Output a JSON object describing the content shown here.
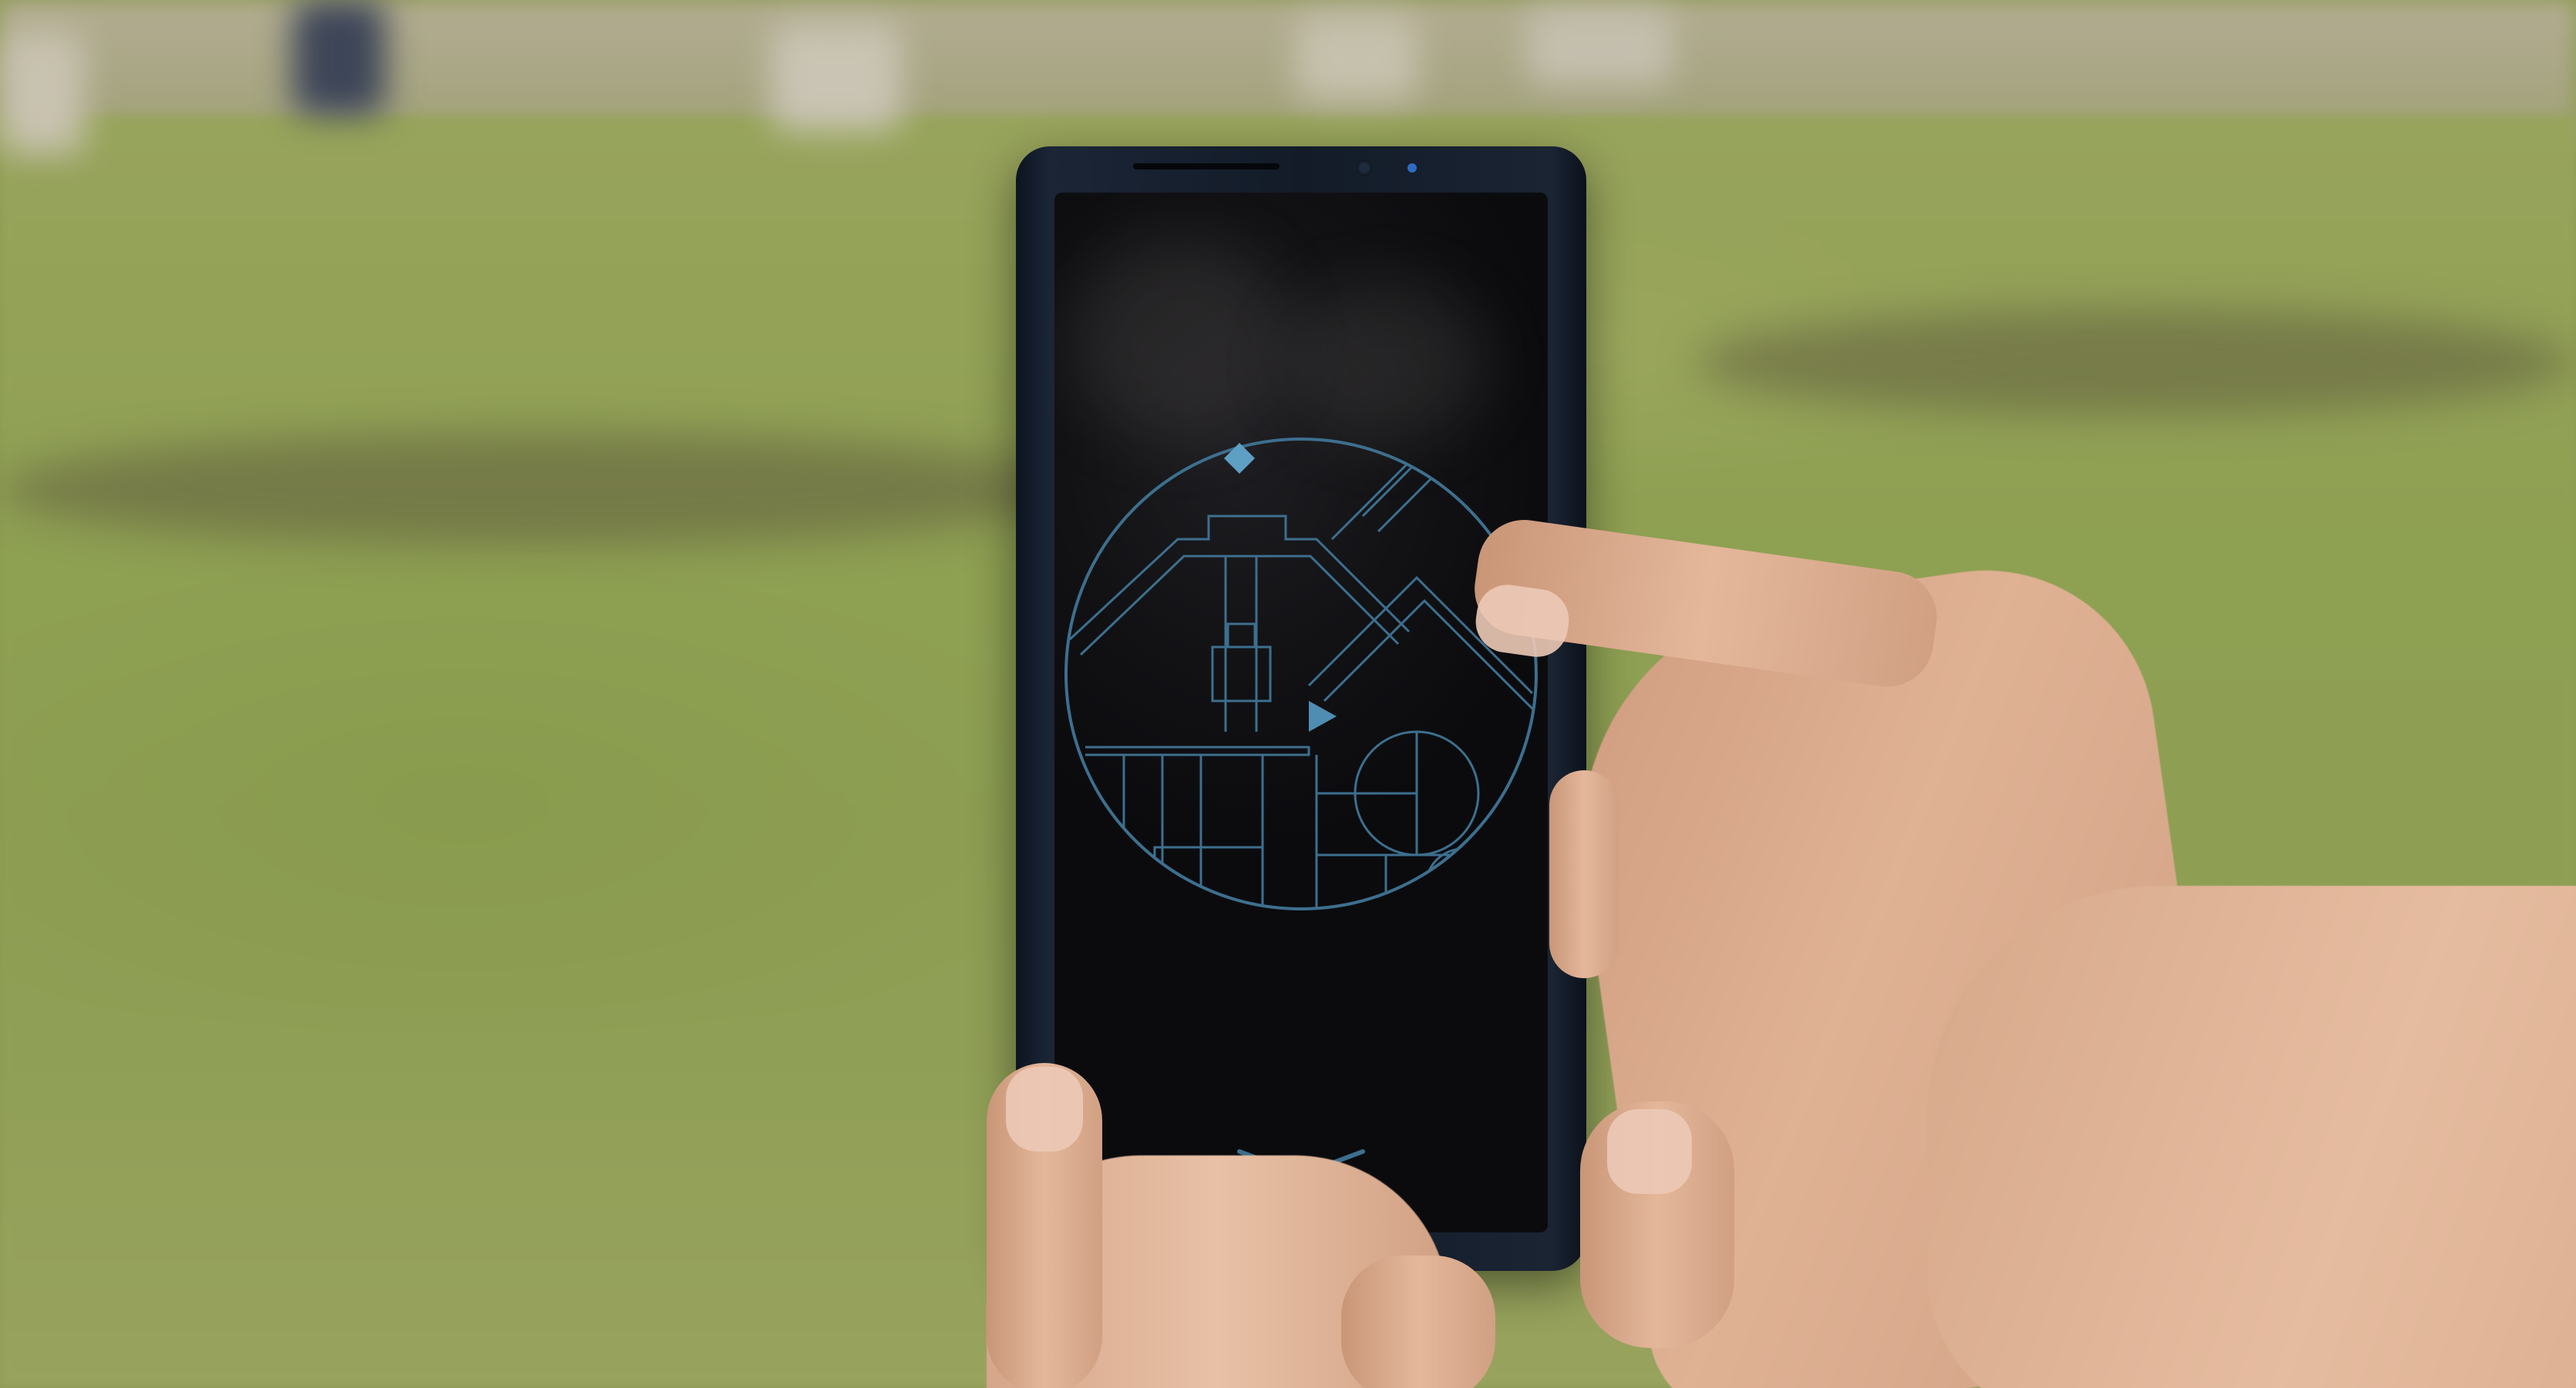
{
  "screen": {
    "label": "",
    "map_color": "#3d6f8e",
    "accent_color": "#5e9fc4"
  },
  "icons": {
    "north_marker": "diamond-icon",
    "position_marker": "triangle-icon",
    "expand": "chevron-down-icon"
  },
  "colors": {
    "grass": "#8ea052",
    "phone_body": "#131b28",
    "skin": "#d5a689"
  }
}
